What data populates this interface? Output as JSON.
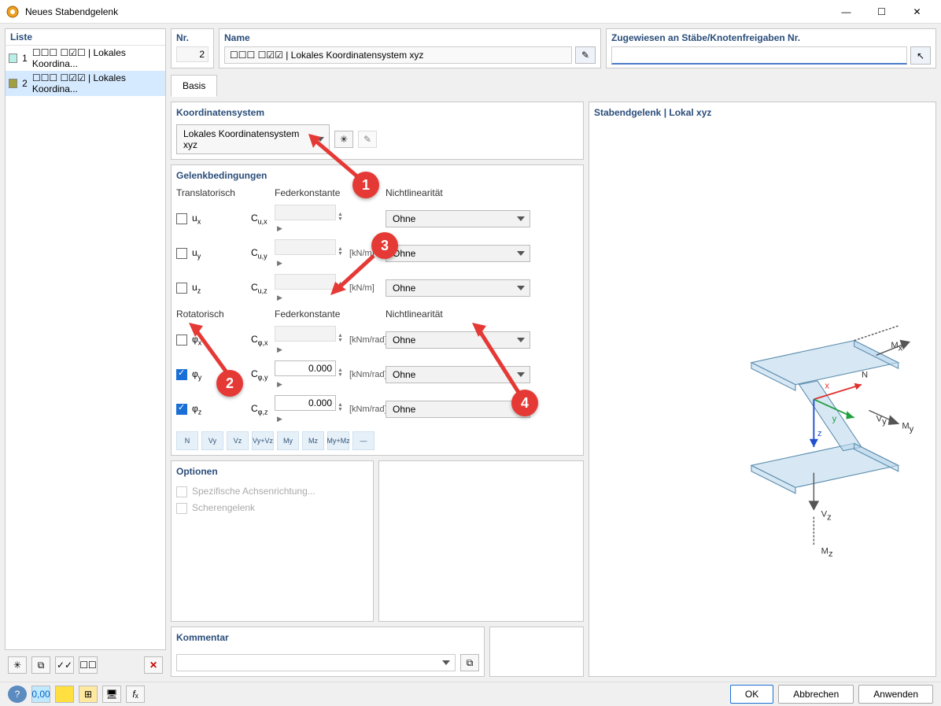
{
  "window": {
    "title": "Neues Stabendgelenk"
  },
  "list": {
    "title": "Liste",
    "items": [
      {
        "num": "1",
        "label": "☐☐☐ ☐☑☐ | Lokales Koordina..."
      },
      {
        "num": "2",
        "label": "☐☐☐ ☐☑☑ | Lokales Koordina..."
      }
    ]
  },
  "nr": {
    "label": "Nr.",
    "value": "2"
  },
  "name": {
    "label": "Name",
    "value": "☐☐☐ ☐☑☑ | Lokales Koordinatensystem xyz"
  },
  "assigned": {
    "label": "Zugewiesen an Stäbe/Knotenfreigaben Nr."
  },
  "tabs": {
    "basis": "Basis"
  },
  "coordsys": {
    "header": "Koordinatensystem",
    "value": "Lokales Koordinatensystem xyz"
  },
  "hinge": {
    "header": "Gelenkbedingungen",
    "trans_hdr": "Translatorisch",
    "spring_hdr": "Federkonstante",
    "nl_hdr": "Nichtlinearität",
    "rot_hdr": "Rotatorisch",
    "u_knm": "[kN/m]",
    "u_knmrad": "[kNm/rad]",
    "rows_trans": [
      {
        "sym": "uₓ",
        "c": "Cu,x",
        "nl": "Ohne"
      },
      {
        "sym": "uᵧ",
        "c": "Cu,y",
        "nl": "Ohne"
      },
      {
        "sym": "u_z",
        "c": "Cu,z",
        "nl": "Ohne"
      }
    ],
    "rows_rot": [
      {
        "sym": "φₓ",
        "c": "Cφ,x",
        "nl": "Ohne"
      },
      {
        "sym": "φᵧ",
        "c": "Cφ,y",
        "val": "0.000",
        "nl": "Ohne"
      },
      {
        "sym": "φ_z",
        "c": "Cφ,z",
        "val": "0.000",
        "nl": "Ohne"
      }
    ],
    "icons": [
      "N",
      "Vy",
      "Vz",
      "Vy+Vz",
      "My",
      "Mz",
      "My+Mz",
      "—"
    ]
  },
  "options": {
    "header": "Optionen",
    "opt1": "Spezifische Achsenrichtung...",
    "opt2": "Scherengelenk"
  },
  "preview": {
    "title": "Stabendgelenk | Lokal xyz"
  },
  "comment": {
    "header": "Kommentar"
  },
  "buttons": {
    "ok": "OK",
    "cancel": "Abbrechen",
    "apply": "Anwenden"
  }
}
